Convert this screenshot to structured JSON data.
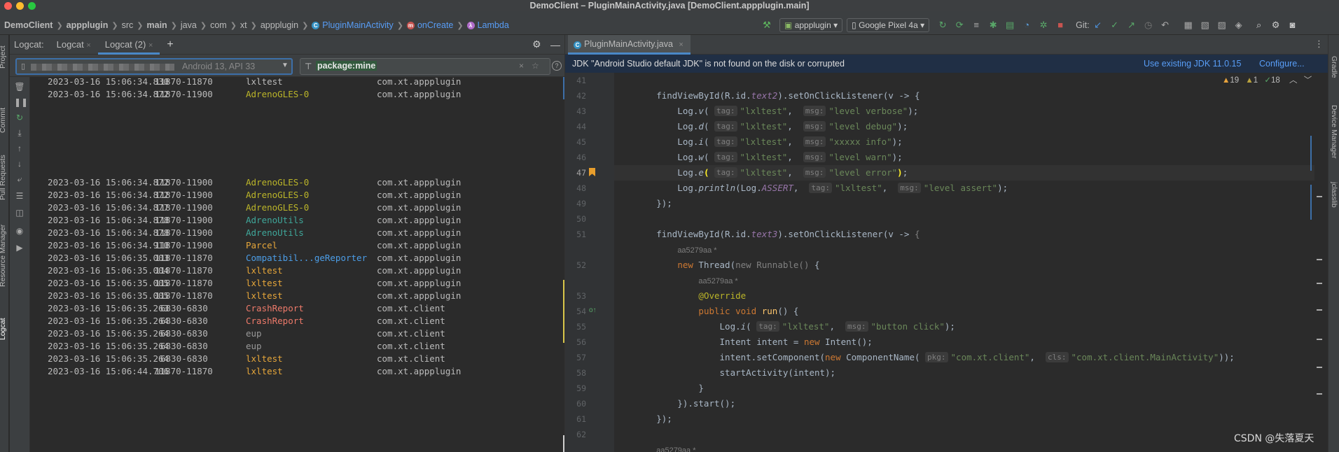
{
  "window": {
    "title": "DemoClient – PluginMainActivity.java [DemoClient.appplugin.main]"
  },
  "breadcrumbs": [
    {
      "label": "DemoClient",
      "bold": true,
      "badge": null
    },
    {
      "label": "appplugin",
      "bold": true,
      "badge": null
    },
    {
      "label": "src",
      "bold": false,
      "badge": null
    },
    {
      "label": "main",
      "bold": true,
      "badge": null
    },
    {
      "label": "java",
      "bold": false,
      "badge": null
    },
    {
      "label": "com",
      "bold": false,
      "badge": null
    },
    {
      "label": "xt",
      "bold": false,
      "badge": null
    },
    {
      "label": "appplugin",
      "bold": false,
      "badge": null
    },
    {
      "label": "PluginMainActivity",
      "bold": false,
      "badge": "C"
    },
    {
      "label": "onCreate",
      "bold": false,
      "badge": "m"
    },
    {
      "label": "Lambda",
      "bold": false,
      "badge": "λ"
    }
  ],
  "toolbar": {
    "run_config": "appplugin",
    "device": "Google Pixel 4a",
    "git_label": "Git:"
  },
  "logcat": {
    "panel_label": "Logcat:",
    "tabs": [
      "Logcat",
      "Logcat (2)"
    ],
    "device_info": "Android 13, API 33",
    "filter": "package:mine",
    "lines": [
      {
        "ts": "2023-03-16 15:06:34.830",
        "pid": "11870-11870",
        "tag": "lxltest",
        "pkg": "com.xt.appplugin",
        "color": "#bbbbbb",
        "row": 0
      },
      {
        "ts": "2023-03-16 15:06:34.872",
        "pid": "11870-11900",
        "tag": "AdrenoGLES-0",
        "pkg": "com.xt.appplugin",
        "color": "#bbb529",
        "row": 1
      },
      {
        "ts": "2023-03-16 15:06:34.872",
        "pid": "11870-11900",
        "tag": "AdrenoGLES-0",
        "pkg": "com.xt.appplugin",
        "color": "#bbb529",
        "row": 8
      },
      {
        "ts": "2023-03-16 15:06:34.872",
        "pid": "11870-11900",
        "tag": "AdrenoGLES-0",
        "pkg": "com.xt.appplugin",
        "color": "#bbb529",
        "row": 9
      },
      {
        "ts": "2023-03-16 15:06:34.877",
        "pid": "11870-11900",
        "tag": "AdrenoGLES-0",
        "pkg": "com.xt.appplugin",
        "color": "#bbb529",
        "row": 10
      },
      {
        "ts": "2023-03-16 15:06:34.878",
        "pid": "11870-11900",
        "tag": "AdrenoUtils",
        "pkg": "com.xt.appplugin",
        "color": "#3fa79a",
        "row": 11
      },
      {
        "ts": "2023-03-16 15:06:34.878",
        "pid": "11870-11900",
        "tag": "AdrenoUtils",
        "pkg": "com.xt.appplugin",
        "color": "#3fa79a",
        "row": 12
      },
      {
        "ts": "2023-03-16 15:06:34.910",
        "pid": "11870-11900",
        "tag": "Parcel",
        "pkg": "com.xt.appplugin",
        "color": "#e6a63a",
        "row": 13
      },
      {
        "ts": "2023-03-16 15:06:35.003",
        "pid": "11870-11870",
        "tag": "Compatibil...geReporter",
        "pkg": "com.xt.appplugin",
        "color": "#4c9ee8",
        "row": 14
      },
      {
        "ts": "2023-03-16 15:06:35.004",
        "pid": "11870-11870",
        "tag": "lxltest",
        "pkg": "com.xt.appplugin",
        "color": "#e6a63a",
        "row": 15
      },
      {
        "ts": "2023-03-16 15:06:35.005",
        "pid": "11870-11870",
        "tag": "lxltest",
        "pkg": "com.xt.appplugin",
        "color": "#e6a63a",
        "row": 16
      },
      {
        "ts": "2023-03-16 15:06:35.005",
        "pid": "11870-11870",
        "tag": "lxltest",
        "pkg": "com.xt.appplugin",
        "color": "#e6a63a",
        "row": 17
      },
      {
        "ts": "2023-03-16 15:06:35.263",
        "pid": "6830-6830",
        "tag": "CrashReport",
        "pkg": "com.xt.client",
        "color": "#ee7a6a",
        "row": 18
      },
      {
        "ts": "2023-03-16 15:06:35.264",
        "pid": "6830-6830",
        "tag": "CrashReport",
        "pkg": "com.xt.client",
        "color": "#ee7a6a",
        "row": 19
      },
      {
        "ts": "2023-03-16 15:06:35.264",
        "pid": "6830-6830",
        "tag": "eup",
        "pkg": "com.xt.client",
        "color": "#999999",
        "row": 20
      },
      {
        "ts": "2023-03-16 15:06:35.264",
        "pid": "6830-6830",
        "tag": "eup",
        "pkg": "com.xt.client",
        "color": "#999999",
        "row": 21
      },
      {
        "ts": "2023-03-16 15:06:35.264",
        "pid": "6830-6830",
        "tag": "lxltest",
        "pkg": "com.xt.client",
        "color": "#e6a63a",
        "row": 22
      },
      {
        "ts": "2023-03-16 15:06:44.706",
        "pid": "11870-11870",
        "tag": "lxltest",
        "pkg": "com.xt.appplugin",
        "color": "#e6a63a",
        "row": 23
      }
    ]
  },
  "editor": {
    "file_tab": "PluginMainActivity.java",
    "banner": {
      "message": "JDK \"Android Studio default JDK\" is not found on the disk or corrupted",
      "action1": "Use existing JDK 11.0.15",
      "action2": "Configure..."
    },
    "inspections": {
      "warnings": "19",
      "weak_warnings": "1",
      "ok": "18"
    },
    "author_hint": "aa5279aa *",
    "line_numbers": [
      "41",
      "42",
      "43",
      "44",
      "45",
      "46",
      "47",
      "48",
      "49",
      "50",
      "51",
      "",
      "52",
      "",
      "53",
      "54",
      "55",
      "56",
      "57",
      "58",
      "59",
      "60",
      "61",
      "62"
    ]
  },
  "side": {
    "left_tabs": [
      "Project",
      "Commit",
      "Pull Requests",
      "Resource Manager",
      "Logcat"
    ],
    "right_tabs": [
      "Gradle",
      "Device Manager",
      "jclasslib"
    ]
  },
  "watermark": "CSDN @失落夏天"
}
